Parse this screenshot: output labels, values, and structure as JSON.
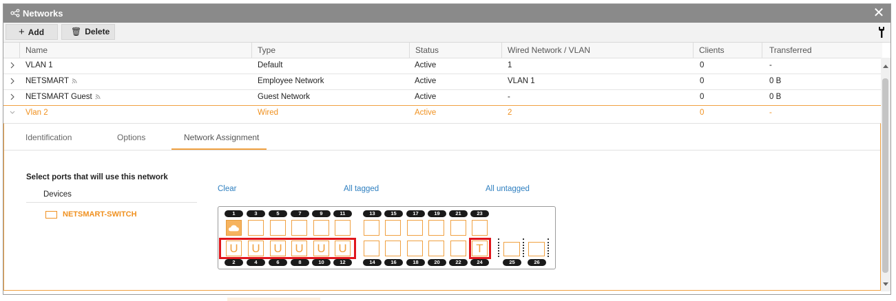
{
  "window": {
    "title": "Networks",
    "close_label": "✕"
  },
  "toolbar": {
    "add_label": "Add",
    "delete_label": "Delete"
  },
  "table": {
    "columns": [
      "Name",
      "Type",
      "Status",
      "Wired Network / VLAN",
      "Clients",
      "Transferred"
    ],
    "rows": [
      {
        "name": "VLAN 1",
        "type": "Default",
        "status": "Active",
        "wired": "1",
        "clients": "0",
        "transferred": "-",
        "wifi": false
      },
      {
        "name": "NETSMART",
        "type": "Employee Network",
        "status": "Active",
        "wired": "VLAN 1",
        "clients": "0",
        "transferred": "0 B",
        "wifi": true
      },
      {
        "name": "NETSMART Guest",
        "type": "Guest Network",
        "status": "Active",
        "wired": "-",
        "clients": "0",
        "transferred": "0 B",
        "wifi": true
      },
      {
        "name": "Vlan 2",
        "type": "Wired",
        "status": "Active",
        "wired": "2",
        "clients": "0",
        "transferred": "-",
        "wifi": false
      }
    ]
  },
  "detail": {
    "tabs": [
      "Identification",
      "Options",
      "Network Assignment"
    ],
    "active_tab": "Network Assignment",
    "instruction": "Select ports that will use this network",
    "devices_header": "Devices",
    "device_name": "NETSMART-SWITCH",
    "links": {
      "clear": "Clear",
      "all_tagged": "All tagged",
      "all_untagged": "All untagged"
    }
  },
  "switch": {
    "top_labels": [
      "1",
      "3",
      "5",
      "7",
      "9",
      "11",
      "13",
      "15",
      "17",
      "19",
      "21",
      "23"
    ],
    "bottom_labels": [
      "2",
      "4",
      "6",
      "8",
      "10",
      "12",
      "14",
      "16",
      "18",
      "20",
      "22",
      "24"
    ],
    "sfp_labels": [
      "25",
      "26"
    ],
    "top_ports": [
      "cloud",
      "",
      "",
      "",
      "",
      "",
      "",
      "",
      "",
      "",
      "",
      ""
    ],
    "bottom_ports": [
      "U",
      "U",
      "U",
      "U",
      "U",
      "U",
      "",
      "",
      "",
      "",
      "",
      "T"
    ],
    "sfp_ports": [
      "",
      ""
    ]
  },
  "colors": {
    "accent": "#f0901e",
    "highlight": "#e0161c",
    "link": "#2e7fc0",
    "titlebar": "#8a8a8a"
  }
}
